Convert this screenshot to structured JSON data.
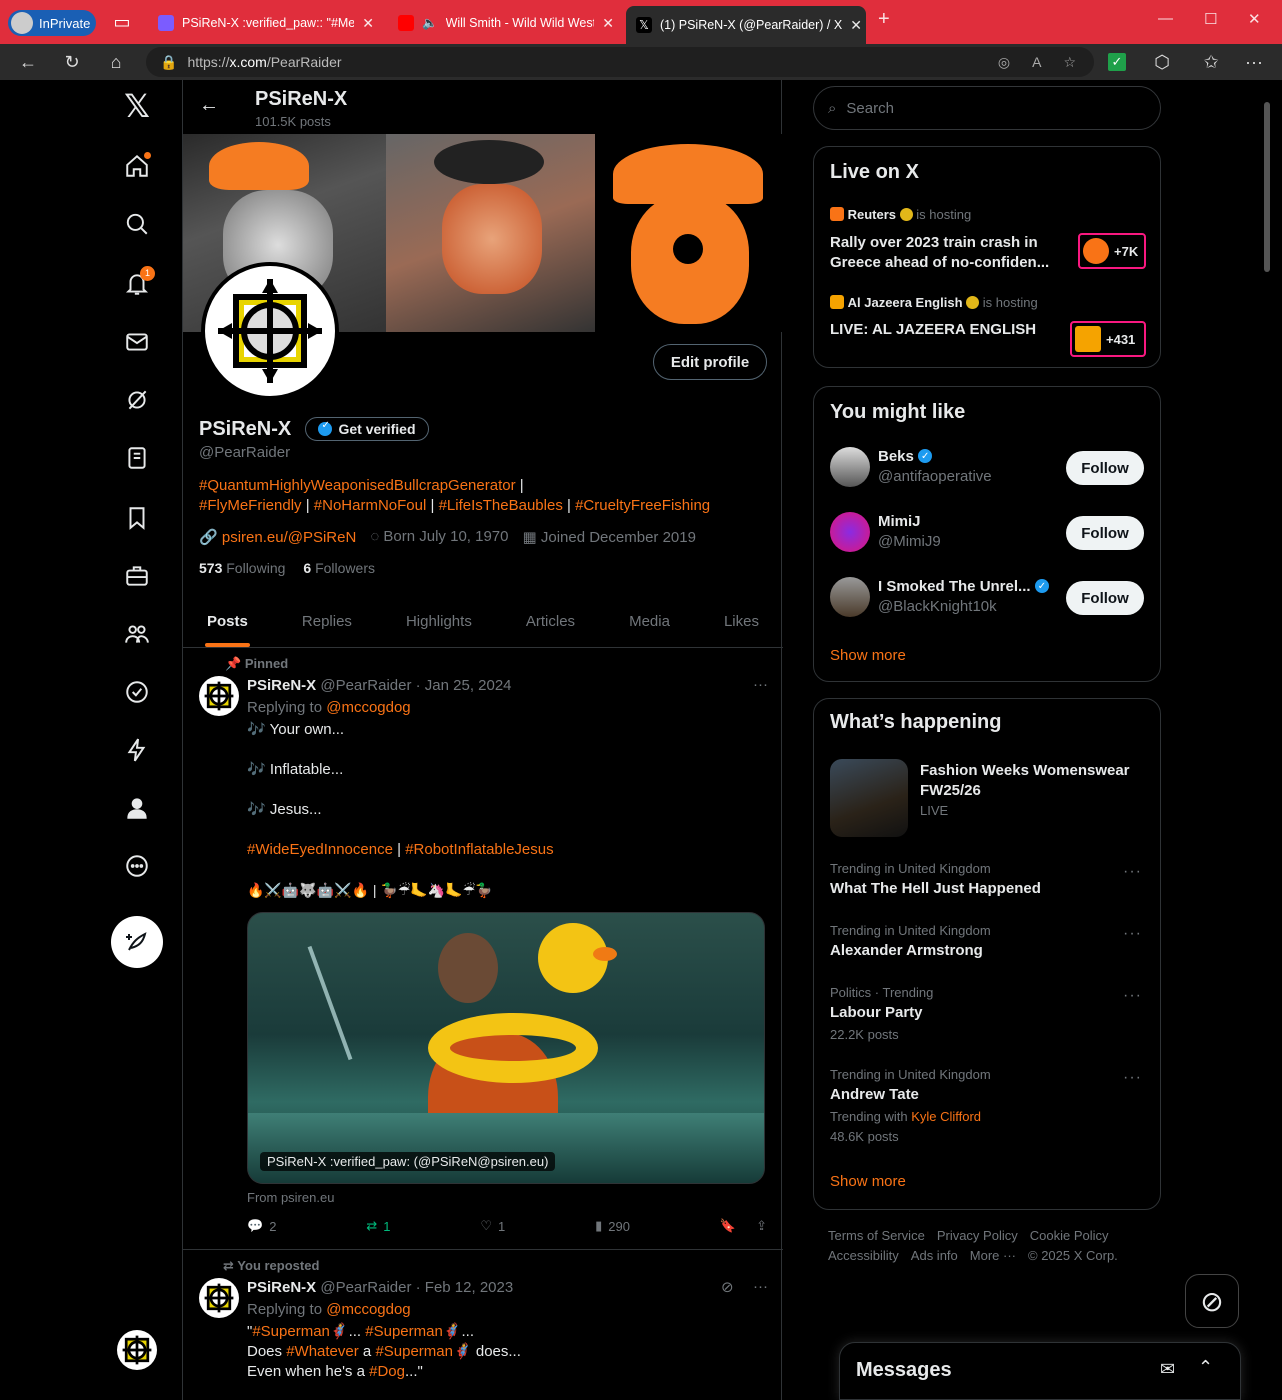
{
  "browser": {
    "inprivate": "InPrivate",
    "tabs": [
      {
        "title": "PSiReN-X :verified_paw:: \"#Meani",
        "fav": "#7b5cff"
      },
      {
        "title": "Will Smith - Wild Wild West",
        "fav": "#ff0000"
      },
      {
        "title": "(1) PSiReN-X (@PearRaider) / X",
        "fav": "#000000"
      }
    ],
    "url_prefix": "https://",
    "url_host": "x.com",
    "url_path": "/PearRaider"
  },
  "header": {
    "title": "PSiReN-X",
    "posts": "101.5K posts"
  },
  "profile": {
    "name": "PSiReN-X",
    "get_verified": "Get verified",
    "handle": "@PearRaider",
    "edit": "Edit profile",
    "bio1": "#QuantumHighlyWeaponisedBullcrapGenerator",
    "bio_sep": "|",
    "bio2a": "#FlyMeFriendly",
    "bio2b": "#NoHarmNoFoul",
    "bio2c": "#LifeIsTheBaubles",
    "bio2d": "#CrueltyFreeFishing",
    "link": "psiren.eu/@PSiReN",
    "born": "Born July 10, 1970",
    "joined": "Joined December 2019",
    "following_n": "573",
    "following_l": "Following",
    "followers_n": "6",
    "followers_l": "Followers"
  },
  "tabs": [
    "Posts",
    "Replies",
    "Highlights",
    "Articles",
    "Media",
    "Likes"
  ],
  "post1": {
    "pinned": "Pinned",
    "name": "PSiReN-X",
    "meta": "@PearRaider · Jan 25, 2024",
    "replying": "Replying to",
    "reply_to": "@mccogdog",
    "l1": "Your own...",
    "l2": "Inflatable...",
    "l3": "Jesus...",
    "tag1": "#WideEyedInnocence",
    "sep": "|",
    "tag2": "#RobotInflatableJesus",
    "emoji": "🔥⚔️🤖🐺🤖⚔️🔥 | 🦆☔🦶🦄🦶☔🦆",
    "img_caption": "PSiReN-X :verified_paw: (@PSiReN@psiren.eu)",
    "from": "From psiren.eu",
    "replies": "2",
    "reposts": "1",
    "likes": "1",
    "views": "290"
  },
  "post2": {
    "reposted": "You reposted",
    "name": "PSiReN-X",
    "meta": "@PearRaider · Feb 12, 2023",
    "replying": "Replying to",
    "reply_to": "@mccogdog",
    "q": "\"",
    "t1": "#Superman",
    "e": "🦸",
    "dots": "...",
    "t2": "#Superman",
    "dots2": "...",
    "does": "Does",
    "t3": "#Whatever",
    "a": "a",
    "t4": "#Superman",
    "does2": "does...",
    "even": "Even when he's a",
    "t5": "#Dog",
    "end": "...\""
  },
  "search": {
    "placeholder": "Search"
  },
  "live": {
    "title": "Live on X",
    "items": [
      {
        "host": "Reuters",
        "is": "is hosting",
        "title1": "Rally over 2023 train crash in",
        "title2": "Greece ahead of no-confiden...",
        "count": "+7K"
      },
      {
        "host": "Al Jazeera English",
        "is": "is hosting",
        "title1": "LIVE: AL JAZEERA ENGLISH",
        "count": "+431"
      }
    ]
  },
  "wtf": {
    "title": "You might like",
    "users": [
      {
        "name": "Beks",
        "handle": "@antifaoperative",
        "btn": "Follow"
      },
      {
        "name": "MimiJ",
        "handle": "@MimiJ9",
        "btn": "Follow"
      },
      {
        "name": "I Smoked The Unrel...",
        "handle": "@BlackKnight10k",
        "btn": "Follow"
      }
    ],
    "more": "Show more"
  },
  "happening": {
    "title": "What’s happening",
    "feature": {
      "title1": "Fashion Weeks Womenswear",
      "title2": "FW25/26",
      "live": "LIVE"
    },
    "trends": [
      {
        "meta": "Trending in United Kingdom",
        "title": "What The Hell Just Happened"
      },
      {
        "meta": "Trending in United Kingdom",
        "title": "Alexander Armstrong"
      },
      {
        "meta": "Politics · Trending",
        "title": "Labour Party",
        "sub": "22.2K posts"
      },
      {
        "meta": "Trending in United Kingdom",
        "title": "Andrew Tate",
        "with": "Trending with",
        "with_name": "Kyle Clifford",
        "sub": "48.6K posts"
      }
    ],
    "more": "Show more"
  },
  "footer": {
    "l1": [
      "Terms of Service",
      "Privacy Policy",
      "Cookie Policy"
    ],
    "l2": [
      "Accessibility",
      "Ads info",
      "More ···",
      "© 2025 X Corp."
    ]
  },
  "messages": {
    "title": "Messages"
  },
  "colors": {
    "accent": "#f97316",
    "verified": "#1d9bf0",
    "live_border": "#f91880"
  }
}
